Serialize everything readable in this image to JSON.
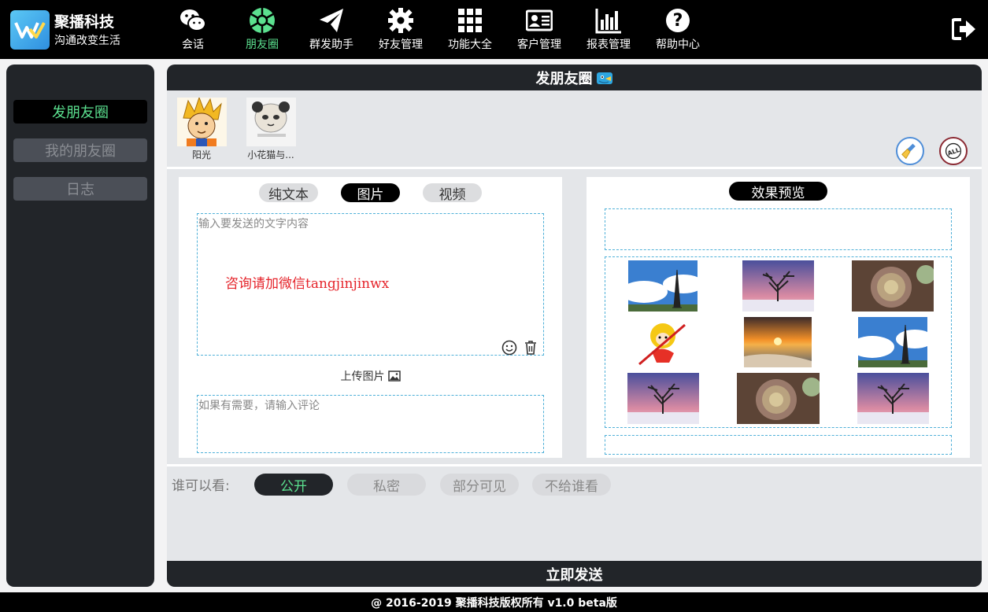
{
  "brand": {
    "title": "聚播科技",
    "subtitle": "沟通改变生活"
  },
  "nav": [
    {
      "label": "会话",
      "icon": "wechat-icon"
    },
    {
      "label": "朋友圈",
      "icon": "moments-icon",
      "active": true
    },
    {
      "label": "群发助手",
      "icon": "send-plane-icon"
    },
    {
      "label": "好友管理",
      "icon": "gear-icon"
    },
    {
      "label": "功能大全",
      "icon": "grid-icon"
    },
    {
      "label": "客户管理",
      "icon": "id-card-icon"
    },
    {
      "label": "报表管理",
      "icon": "bar-chart-icon"
    },
    {
      "label": "帮助中心",
      "icon": "help-icon"
    }
  ],
  "sidebar": {
    "items": [
      {
        "label": "发朋友圈",
        "active": true
      },
      {
        "label": "我的朋友圈",
        "active": false
      },
      {
        "label": "日志",
        "active": false
      }
    ]
  },
  "header": {
    "title": "发朋友圈"
  },
  "friends": [
    {
      "name": "阳光"
    },
    {
      "name": "小花猫与..."
    }
  ],
  "editor": {
    "tabs": [
      {
        "label": "纯文本",
        "active": false
      },
      {
        "label": "图片",
        "active": true
      },
      {
        "label": "视频",
        "active": false
      }
    ],
    "text_placeholder": "输入要发送的文字内容",
    "watermark": "咨询请加微信tangjinjinwx",
    "upload_label": "上传图片",
    "comment_placeholder": "如果有需要，请输入评论"
  },
  "preview": {
    "title": "效果预览"
  },
  "visibility": {
    "label": "谁可以看:",
    "options": [
      {
        "label": "公开",
        "active": true
      },
      {
        "label": "私密",
        "active": false
      },
      {
        "label": "部分可见",
        "active": false
      },
      {
        "label": "不给谁看",
        "active": false
      }
    ]
  },
  "send_label": "立即发送",
  "footer": "@ 2016-2019 聚播科技版权所有 v1.0 beta版",
  "colors": {
    "accent": "#5be08f",
    "dark": "#222529",
    "dashed": "#4fb0d8",
    "watermark": "#e5232a"
  }
}
